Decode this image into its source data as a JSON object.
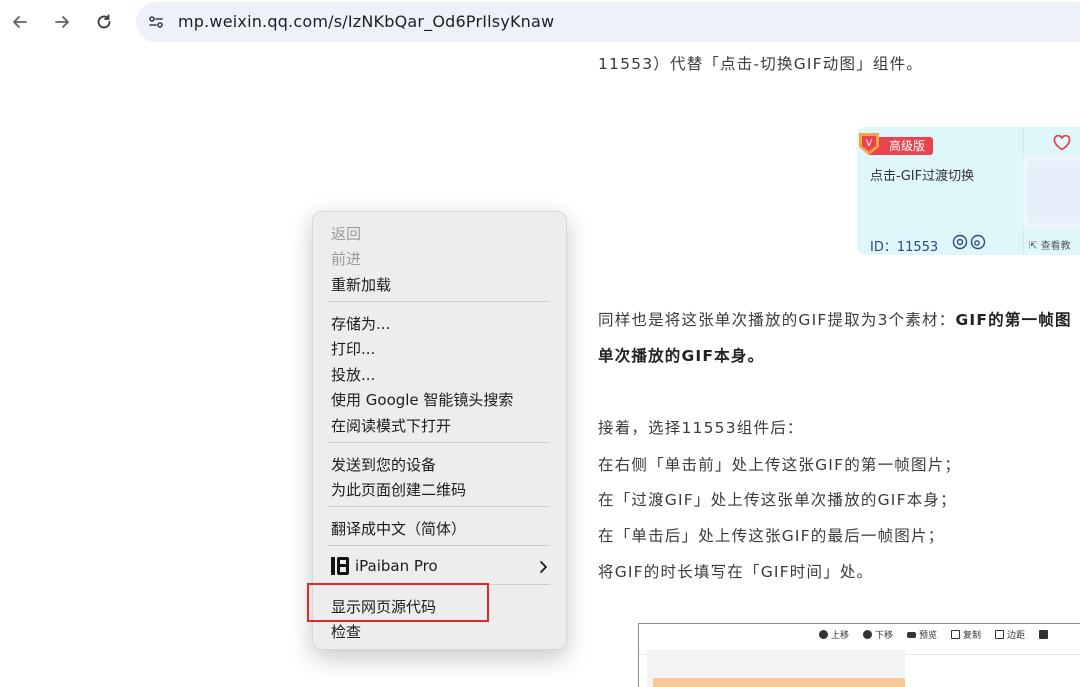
{
  "browser": {
    "url": "mp.weixin.qq.com/s/IzNKbQar_Od6PrIlsyKnaw",
    "icons": [
      "back-arrow-icon",
      "forward-arrow-icon",
      "reload-icon",
      "site-info-icon"
    ]
  },
  "article": {
    "line_top": "11553）代替「点击-切换GIF动图」组件。",
    "para1_line1_normal": "同样也是将这张单次播放的GIF提取为3个素材：",
    "para1_line1_bold": "GIF的第一帧图",
    "para1_line2": "单次播放的GIF本身。",
    "step_intro": "接着，选择11553组件后：",
    "step1": "在右侧「单击前」处上传这张GIF的第一帧图片；",
    "step2": "在「过渡GIF」处上传这张单次播放的GIF本身；",
    "step3": "在「单击后」处上传这张GIF的最后一帧图片；",
    "step4": "将GIF的时长填写在「GIF时间」处。"
  },
  "card": {
    "badge": "高级版",
    "title": "点击-GIF过渡切换",
    "id": "ID：11553",
    "view_link": "查看教",
    "colors": {
      "bg": "#dff6fb",
      "badge": "#e8434f"
    }
  },
  "screenshot_toolbar": {
    "items": [
      "上移",
      "下移",
      "预览",
      "复制",
      "边距"
    ]
  },
  "context_menu": {
    "back": "返回",
    "forward": "前进",
    "reload": "重新加载",
    "save_as": "存储为...",
    "print": "打印...",
    "cast": "投放...",
    "google_lens": "使用 Google 智能镜头搜索",
    "reader_mode": "在阅读模式下打开",
    "send_to_devices": "发送到您的设备",
    "create_qr": "为此页面创建二维码",
    "translate": "翻译成中文（简体）",
    "ipaiban": "iPaiban Pro",
    "view_source": "显示网页源代码",
    "inspect": "检查"
  },
  "colors": {
    "highlight": "#e02a2a",
    "menu_bg": "#ececec"
  }
}
